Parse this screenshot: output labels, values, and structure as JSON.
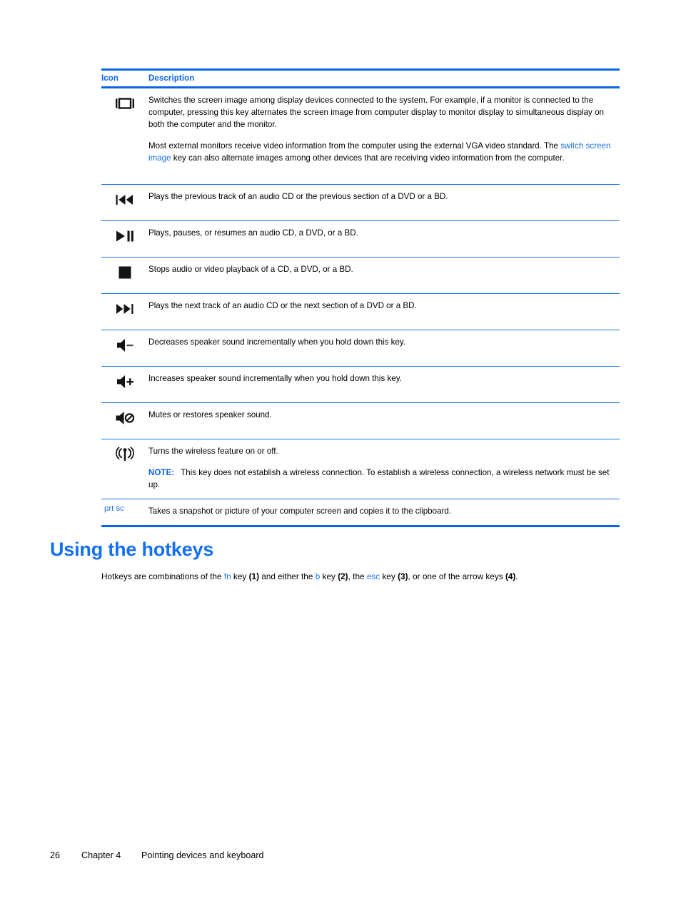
{
  "table": {
    "headers": {
      "icon": "Icon",
      "description": "Description"
    },
    "rows": [
      {
        "icon_name": "switch-screen-image-icon",
        "icon_type": "monitor",
        "paragraphs": [
          {
            "segments": [
              {
                "text": "Switches the screen image among display devices connected to the system. For example, if a monitor is connected to the computer, pressing this key alternates the screen image from computer display to monitor display to simultaneous display on both the computer and the monitor.",
                "style": "plain"
              }
            ]
          },
          {
            "segments": [
              {
                "text": "Most external monitors receive video information from the computer using the external VGA video standard. The ",
                "style": "plain"
              },
              {
                "text": "switch screen image",
                "style": "blue"
              },
              {
                "text": " key can also alternate images among other devices that are receiving video information from the computer.",
                "style": "plain"
              }
            ]
          }
        ]
      },
      {
        "icon_name": "previous-track-icon",
        "icon_type": "prev",
        "paragraphs": [
          {
            "segments": [
              {
                "text": "Plays the previous track of an audio CD or the previous section of a DVD or a BD.",
                "style": "plain"
              }
            ]
          }
        ]
      },
      {
        "icon_name": "play-pause-icon",
        "icon_type": "playpause",
        "paragraphs": [
          {
            "segments": [
              {
                "text": "Plays, pauses, or resumes an audio CD, a DVD, or a BD.",
                "style": "plain"
              }
            ]
          }
        ]
      },
      {
        "icon_name": "stop-icon",
        "icon_type": "stop",
        "paragraphs": [
          {
            "segments": [
              {
                "text": "Stops audio or video playback of a CD, a DVD, or a BD.",
                "style": "plain"
              }
            ]
          }
        ]
      },
      {
        "icon_name": "next-track-icon",
        "icon_type": "next",
        "paragraphs": [
          {
            "segments": [
              {
                "text": "Plays the next track of an audio CD or the next section of a DVD or a BD.",
                "style": "plain"
              }
            ]
          }
        ]
      },
      {
        "icon_name": "volume-down-icon",
        "icon_type": "voldown",
        "paragraphs": [
          {
            "segments": [
              {
                "text": "Decreases speaker sound incrementally when you hold down this key.",
                "style": "plain"
              }
            ]
          }
        ]
      },
      {
        "icon_name": "volume-up-icon",
        "icon_type": "volup",
        "paragraphs": [
          {
            "segments": [
              {
                "text": "Increases speaker sound incrementally when you hold down this key.",
                "style": "plain"
              }
            ]
          }
        ]
      },
      {
        "icon_name": "mute-icon",
        "icon_type": "mute",
        "paragraphs": [
          {
            "segments": [
              {
                "text": "Mutes or restores speaker sound.",
                "style": "plain"
              }
            ]
          }
        ]
      },
      {
        "icon_name": "wireless-icon",
        "icon_type": "wireless",
        "paragraphs": [
          {
            "segments": [
              {
                "text": "Turns the wireless feature on or off.",
                "style": "plain"
              }
            ]
          },
          {
            "segments": [
              {
                "text": "NOTE:",
                "style": "note"
              },
              {
                "text": "This key does not establish a wireless connection. To establish a wireless connection, a wireless network must be set up.",
                "style": "plain"
              }
            ]
          }
        ]
      },
      {
        "icon_name": "prt-sc-key-label",
        "icon_type": "textkey",
        "key_label": "prt sc",
        "paragraphs": [
          {
            "segments": [
              {
                "text": "Takes a snapshot or picture of your computer screen and copies it to the clipboard.",
                "style": "plain"
              }
            ]
          }
        ]
      }
    ]
  },
  "section": {
    "heading": "Using the hotkeys",
    "paragraph_segments": [
      {
        "text": "Hotkeys are combinations of the ",
        "style": "plain"
      },
      {
        "text": "fn",
        "style": "blue"
      },
      {
        "text": " key ",
        "style": "plain"
      },
      {
        "text": "(1)",
        "style": "bold"
      },
      {
        "text": " and either the ",
        "style": "plain"
      },
      {
        "text": "b",
        "style": "blue"
      },
      {
        "text": " key ",
        "style": "plain"
      },
      {
        "text": "(2)",
        "style": "bold"
      },
      {
        "text": ", the ",
        "style": "plain"
      },
      {
        "text": "esc",
        "style": "blue"
      },
      {
        "text": " key ",
        "style": "plain"
      },
      {
        "text": "(3)",
        "style": "bold"
      },
      {
        "text": ", or one of the arrow keys ",
        "style": "plain"
      },
      {
        "text": "(4)",
        "style": "bold"
      },
      {
        "text": ".",
        "style": "plain"
      }
    ]
  },
  "footer": {
    "page_number": "26",
    "chapter": "Chapter 4",
    "chapter_title": "Pointing devices and keyboard"
  },
  "colors": {
    "accent_blue": "#0a64e8",
    "link_blue": "#1b72e8",
    "heading_blue": "#1470f0",
    "text_black": "#000000"
  }
}
